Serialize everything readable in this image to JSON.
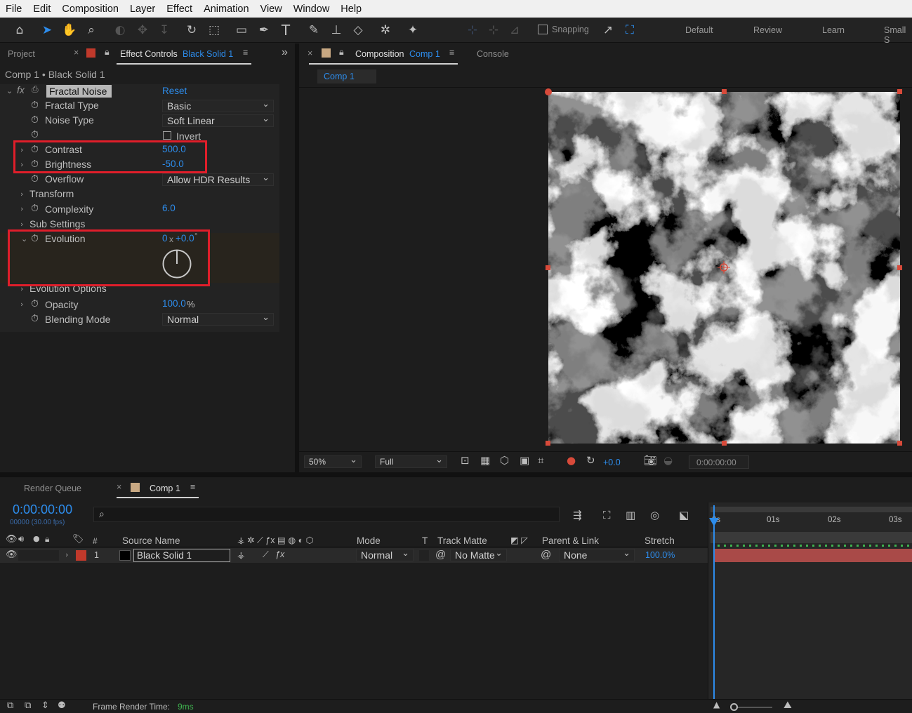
{
  "menu": [
    "File",
    "Edit",
    "Composition",
    "Layer",
    "Effect",
    "Animation",
    "View",
    "Window",
    "Help"
  ],
  "toolbar": {
    "snapping_label": "Snapping",
    "workspaces": [
      "Default",
      "Review",
      "Learn",
      "Small S"
    ]
  },
  "left_panel": {
    "tab_project": "Project",
    "tab_effect_controls": "Effect Controls",
    "tab_effect_layer": "Black Solid 1",
    "subtitle": "Comp 1 • Black Solid 1",
    "effect_name": "Fractal Noise",
    "reset": "Reset",
    "props": {
      "fractal_type": {
        "label": "Fractal Type",
        "value": "Basic"
      },
      "noise_type": {
        "label": "Noise Type",
        "value": "Soft Linear"
      },
      "invert": {
        "label": "Invert"
      },
      "contrast": {
        "label": "Contrast",
        "value": "500.0"
      },
      "brightness": {
        "label": "Brightness",
        "value": "-50.0"
      },
      "overflow": {
        "label": "Overflow",
        "value": "Allow HDR Results"
      },
      "transform": {
        "label": "Transform"
      },
      "complexity": {
        "label": "Complexity",
        "value": "6.0"
      },
      "sub_settings": {
        "label": "Sub Settings"
      },
      "evolution": {
        "label": "Evolution",
        "value_rev": "0",
        "value_x": "x",
        "value_deg": "+0.0",
        "value_unit": "°"
      },
      "evolution_options": {
        "label": "Evolution Options"
      },
      "opacity": {
        "label": "Opacity",
        "value": "100.0",
        "unit": "%"
      },
      "blending_mode": {
        "label": "Blending Mode",
        "value": "Normal"
      }
    }
  },
  "comp_panel": {
    "tab_label": "Composition",
    "tab_comp": "Comp 1",
    "tab_console": "Console",
    "flow_tab": "Comp 1",
    "zoom": "50%",
    "resolution": "Full",
    "exposure": "+0.0",
    "timecode": "0:00:00:00"
  },
  "timeline": {
    "tab_render_queue": "Render Queue",
    "tab_comp": "Comp 1",
    "current_time": "0:00:00:00",
    "frame_info": "00000 (30.00 fps)",
    "columns": {
      "num": "#",
      "source_name": "Source Name",
      "mode": "Mode",
      "t": "T",
      "track_matte": "Track Matte",
      "parent": "Parent & Link",
      "stretch": "Stretch"
    },
    "ruler": [
      "0s",
      "01s",
      "02s",
      "03s"
    ],
    "layer": {
      "index": "1",
      "name": "Black Solid 1",
      "mode": "Normal",
      "track_matte": "No Matte",
      "parent": "None",
      "stretch": "100.0%",
      "label_color": "#c0392b"
    }
  },
  "status": {
    "label": "Frame Render Time:",
    "value": "9ms"
  },
  "colors": {
    "accent": "#2d8ceb",
    "highlight_box": "#e01e2a",
    "layer_bar": "#a94a48"
  }
}
